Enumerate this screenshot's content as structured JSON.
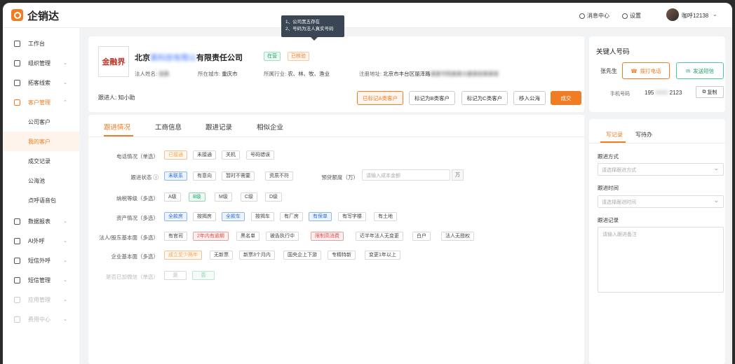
{
  "brand": {
    "name": "企销达"
  },
  "topbar": {
    "messages": "消息中心",
    "settings": "设置",
    "user": "咖呼12138"
  },
  "sidebar": {
    "items": [
      {
        "label": "工作台"
      },
      {
        "label": "组织管理"
      },
      {
        "label": "拓客线索"
      },
      {
        "label": "客户管理"
      },
      {
        "label": "公司客户"
      },
      {
        "label": "我的客户"
      },
      {
        "label": "成交记录"
      },
      {
        "label": "公海池"
      },
      {
        "label": "点呼语音包"
      },
      {
        "label": "数据报表"
      },
      {
        "label": "AI外呼"
      },
      {
        "label": "短信外呼"
      },
      {
        "label": "短信管理"
      },
      {
        "label": "应用管理"
      },
      {
        "label": "费用中心"
      }
    ]
  },
  "tooltip": {
    "line1": "1、公司黑五存在",
    "line2": "2、号码为法人真实号码"
  },
  "company": {
    "logo_text": "金融界",
    "name_prefix": "北京",
    "name_hidden": "某科技有限公",
    "name_suffix": "有限责任公司",
    "status": "在营",
    "risk": "已核验",
    "legal_label": "法人姓名:",
    "legal_value": "张某",
    "city_label": "所在城市:",
    "city_value": "重庆市",
    "industry_label": "所属行业:",
    "industry_value": "农、林、牧、渔业",
    "address_label": "注册地址:",
    "address_value": "北京市丰台区丽泽路",
    "address_hidden": "某某号院某某大厦某层某某室",
    "follower_label": "跟进人:",
    "follower_value": "知小助"
  },
  "actions": {
    "mark_a": "已标记A类客户",
    "mark_b": "标记为B类客户",
    "mark_c": "标记为C类客户",
    "to_pool": "移入公海",
    "deal": "成交"
  },
  "tabs": [
    "跟进情况",
    "工商信息",
    "跟进记录",
    "相似企业"
  ],
  "form": {
    "call_label": "电话情况（单选）",
    "call_opts": [
      "已接通",
      "未接通",
      "关机",
      "号码错误"
    ],
    "follow_label": "跟进状态 ⓘ",
    "follow_opts": [
      "未联系",
      "有意向",
      "暂时不需要",
      "资质不符"
    ],
    "budget_label": "预贷额度（万）",
    "budget_placeholder": "请输入成本金额",
    "budget_unit": "万",
    "tax_label": "纳税等级（多选）",
    "tax_opts": [
      "A级",
      "B级",
      "M级",
      "C级",
      "D级"
    ],
    "asset_label": "资产情况（多选）",
    "asset_opts": [
      "全款房",
      "按揭房",
      "全款车",
      "按揭车",
      "有厂房",
      "有保单",
      "有写字楼",
      "有土地"
    ],
    "legal_label": "法人/股东基本面（多选）",
    "legal_opts": [
      "有官司",
      "2年内有逾期",
      "黑名单",
      "被告执行中",
      "限制高消费",
      "近半年法人无变更",
      "白户",
      "法人无授权"
    ],
    "ent_label": "企业基本面（多选）",
    "ent_opts": [
      "成立至少两年",
      "无新票",
      "新票3个月内",
      "国央企上下游",
      "专精特新",
      "变更1年以上"
    ],
    "wx_label": "是否已加微信（单选）",
    "wx_opts": [
      "是",
      "否"
    ]
  },
  "key_contact": {
    "title": "关键人号码",
    "name": "张先生",
    "call_btn": "拨打电话",
    "sms_btn": "发送短信",
    "phone_label": "手机号码",
    "phone_prefix": "195",
    "phone_hidden": "0000",
    "phone_suffix": "2123",
    "copy_btn": "复制"
  },
  "record": {
    "tab1": "写记录",
    "tab2": "写待办",
    "method_label": "跟进方式",
    "method_placeholder": "请选择跟进方式",
    "time_label": "跟进时间",
    "time_placeholder": "请选择跟进时间",
    "note_label": "跟进记录",
    "note_placeholder": "请输入跟进备注"
  }
}
